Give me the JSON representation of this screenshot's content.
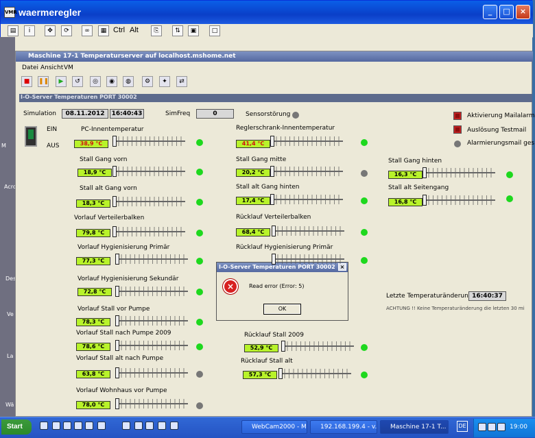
{
  "outer_window": {
    "title": "waermeregler",
    "app_icon": "VMR",
    "min": "_",
    "max": "□",
    "close": "×"
  },
  "toolbar1": {
    "ctrl": "Ctrl",
    "alt": "Alt"
  },
  "left_strip": [
    "M",
    "Acro",
    "Des",
    "Ve",
    "La",
    "Wä"
  ],
  "inner_window": {
    "title": "Maschine 17-1 Temperaturserver auf localhost.mshome.net"
  },
  "menu": [
    "Datei",
    "Ansicht",
    "VM"
  ],
  "panel_title": "I-O-Server Temperaturen PORT 30002",
  "simulation": {
    "label": "Simulation",
    "date": "08.11.2012",
    "time": "16:40:43",
    "simfreq_label": "SimFreq",
    "simfreq": "0",
    "sensor_label": "Sensorstörung"
  },
  "switch": {
    "on": "EIN",
    "off": "AUS"
  },
  "alarms": [
    "Aktivierung Mailalarm",
    "Auslösung Testmail",
    "Alarmierungsmail ges"
  ],
  "sensors_left": [
    {
      "label": "PC-Innentemperatur",
      "value": "38,9 °C",
      "red": true,
      "pos": 0.0,
      "status": "on"
    },
    {
      "label": "Stall Gang vorn",
      "value": "18,9 °C",
      "pos": 0.0,
      "status": "on"
    },
    {
      "label": "Stall alt Gang vorn",
      "value": "18,3 °C",
      "pos": 0.0,
      "status": "on"
    },
    {
      "label": "Vorlauf Verteilerbalken",
      "value": "79,8 °C",
      "pos": 0.0,
      "status": "on"
    },
    {
      "label": "Vorlauf Hygienisierung Primär",
      "value": "77,3 °C",
      "pos": 0.0,
      "status": "on"
    },
    {
      "label": "Vorlauf Hygienisierung Sekundär",
      "value": "72,8 °C",
      "pos": 0.0,
      "status": "on"
    },
    {
      "label": "Vorlauf Stall vor Pumpe",
      "value": "78,3 °C",
      "pos": 0.0,
      "status": "on"
    },
    {
      "label": "Vorlauf Stall nach Pumpe 2009",
      "value": "78,6 °C",
      "pos": 0.0,
      "status": "on"
    },
    {
      "label": "Vorlauf Stall alt nach Pumpe",
      "value": "63,8 °C",
      "pos": 0.0,
      "status": "off"
    },
    {
      "label": "Vorlauf Wohnhaus vor Pumpe",
      "value": "78,0 °C",
      "pos": 0.0,
      "status": "off"
    }
  ],
  "sensors_mid": [
    {
      "label": "Reglerschrank-Innentemperatur",
      "value": "41,4 °C",
      "red": true,
      "status": "on"
    },
    {
      "label": "Stall Gang mitte",
      "value": "20,2 °C",
      "status": "off"
    },
    {
      "label": "Stall alt Gang hinten",
      "value": "17,4 °C",
      "status": "on"
    },
    {
      "label": "Rücklauf Verteilerbalken",
      "value": "68,4 °C",
      "status": "on"
    },
    {
      "label": "Rücklauf Hygienisierung Primär",
      "value": "",
      "status": "on"
    },
    {
      "label": "Rücklauf Stall 2009",
      "value": "52,9 °C",
      "status": "on"
    },
    {
      "label": "Rücklauf Stall alt",
      "value": "57,3 °C",
      "status": "on"
    }
  ],
  "sensors_right": [
    {
      "label": "Stall Gang hinten",
      "value": "16,3 °C",
      "status": "on"
    },
    {
      "label": "Stall alt Seitengang",
      "value": "16,8 °C",
      "status": "on"
    }
  ],
  "last_change": {
    "label": "Letzte Temperaturänderung",
    "time": "16:40:37",
    "warning": "ACHTUNG !! Keine Temperaturänderung die  letzten 30 mi"
  },
  "dialog": {
    "title": "I-O-Server Temperaturen PORT 30002",
    "message": "Read error (Error: 5)",
    "ok": "OK",
    "close": "×",
    "icon": "×"
  },
  "taskbar": {
    "start": "Start",
    "tasks": [
      "WebCam2000 - Mi...",
      "192.168.199.4 - v...",
      "Maschine 17-1 T..."
    ],
    "lang": "DE",
    "clock": "19:00"
  }
}
